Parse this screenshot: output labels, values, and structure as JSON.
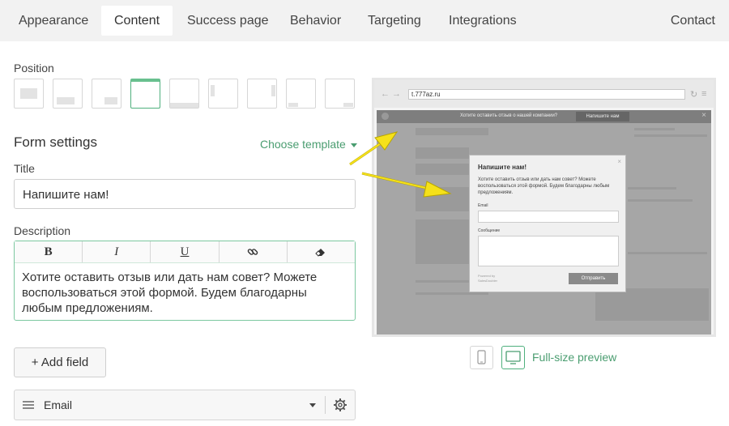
{
  "nav": {
    "tabs": [
      {
        "label": "Appearance"
      },
      {
        "label": "Content"
      },
      {
        "label": "Success page"
      },
      {
        "label": "Behavior"
      },
      {
        "label": "Targeting"
      },
      {
        "label": "Integrations"
      }
    ],
    "active_tab": "Content",
    "contact": "Contact"
  },
  "position": {
    "label": "Position",
    "selected_index": 3
  },
  "form_settings": {
    "heading": "Form settings",
    "choose_template": "Choose template",
    "title_label": "Title",
    "title_value": "Напишите нам!",
    "description_label": "Description",
    "toolbar": {
      "bold": "B",
      "italic": "I",
      "underline": "U"
    },
    "description_value": "Хотите оставить отзыв или дать нам совет? Можете воспользоваться этой формой. Будем благодарны любым предложениям.",
    "add_field": "+ Add field",
    "field_name": "Email"
  },
  "preview": {
    "url": "t.777az.ru",
    "banner_text": "Хотите оставить отзыв о нашей компании?",
    "banner_button": "Напишите нам",
    "close_char": "×",
    "form_title": "Напишите нам!",
    "form_description": "Хотите оставить отзыв или дать нам совет? Можете воспользоваться этой формой. Будем благодарны любым предложениям.",
    "email_label": "Email",
    "message_label": "Сообщение",
    "powered_by": "Powered by",
    "powered_name": "SalesDoubler",
    "send_button": "Отправить",
    "full_size_preview": "Full-size preview"
  },
  "colors": {
    "accent_green": "#4a9d70",
    "arrow_yellow": "#f5e11a"
  }
}
